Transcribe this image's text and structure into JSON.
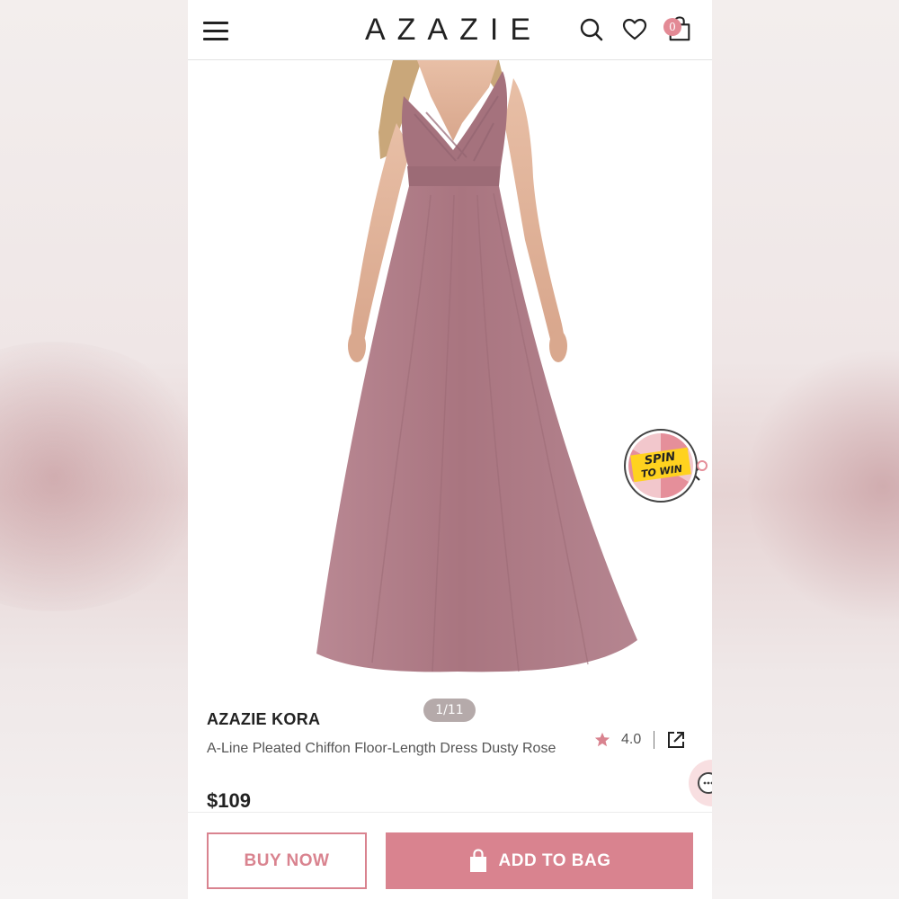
{
  "header": {
    "brand": "AZAZIE",
    "bag_count": "0",
    "icons": [
      "menu-icon",
      "search-icon",
      "heart-icon",
      "shopping-bag-icon"
    ]
  },
  "gallery": {
    "counter": "1/11"
  },
  "promo": {
    "spin_top": "SPIN",
    "spin_bottom": "TO WIN"
  },
  "product": {
    "brand_name": "AZAZIE KORA",
    "title": "A-Line Pleated Chiffon Floor-Length Dress Dusty Rose",
    "price": "$109",
    "rating": "4.0"
  },
  "actions": {
    "buy_now": "BUY NOW",
    "add_to_bag": "ADD TO BAG"
  },
  "colors": {
    "accent": "#d9838f",
    "dress": "#a97580",
    "badge": "#e38a95"
  }
}
